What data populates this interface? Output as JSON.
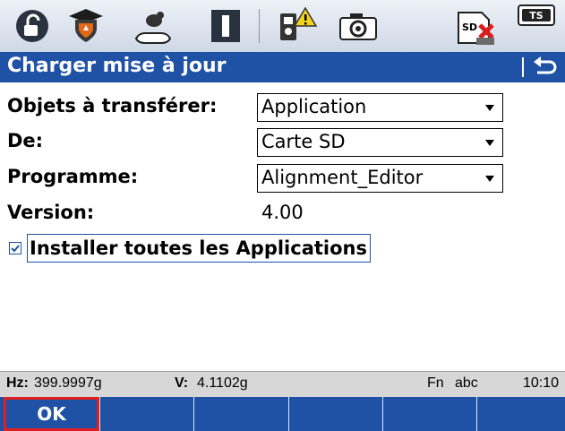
{
  "toolbar": {
    "icons": [
      "lock-icon",
      "shield-icon",
      "survey-target-icon",
      "info-icon",
      "instrument-warning-icon",
      "camera-icon",
      "sd-card-error-icon",
      "ts-badge-icon"
    ],
    "ts_badge": "TS",
    "sd_badge": "SD"
  },
  "title_bar": {
    "title": "Charger mise à jour"
  },
  "form": {
    "objects_label": "Objets à transférer:",
    "objects_value": "Application",
    "from_label": "De:",
    "from_value": "Carte SD",
    "program_label": "Programme:",
    "program_value": "Alignment_Editor",
    "version_label": "Version:",
    "version_value": "4.00",
    "install_all_label": "Installer toutes les Applications",
    "install_all_checked": true
  },
  "status": {
    "hz_label": "Hz:",
    "hz_value": "399.9997g",
    "v_label": "V:",
    "v_value": "4.1102g",
    "fn": "Fn",
    "input_mode": "abc",
    "time": "10:10"
  },
  "softkeys": {
    "ok_label": "OK"
  },
  "colors": {
    "accent": "#1f52a5",
    "highlight": "#e02020"
  }
}
